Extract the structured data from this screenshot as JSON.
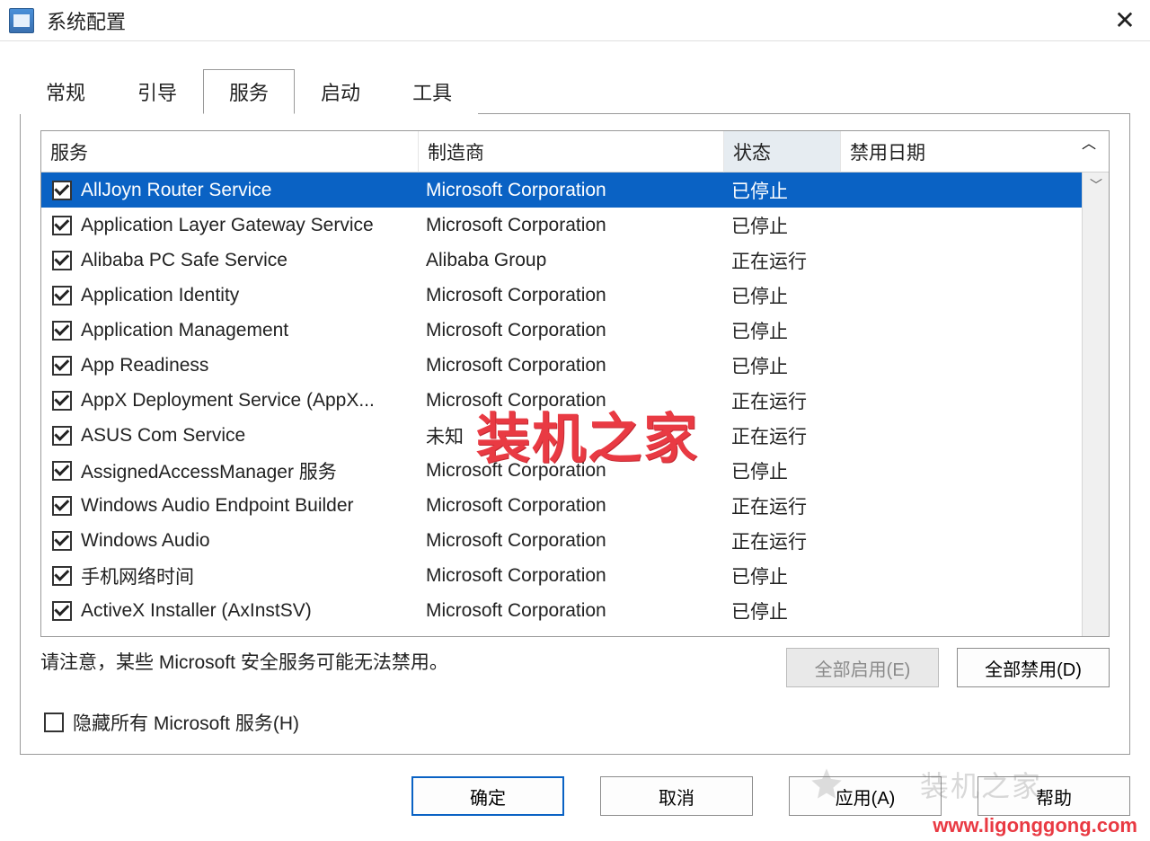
{
  "title": "系统配置",
  "tabs": [
    "常规",
    "引导",
    "服务",
    "启动",
    "工具"
  ],
  "activeTab": 2,
  "columns": {
    "service": "服务",
    "manufacturer": "制造商",
    "status": "状态",
    "disableDate": "禁用日期"
  },
  "sortedColumnIndex": 2,
  "rows": [
    {
      "checked": true,
      "service": "AllJoyn Router Service",
      "mfr": "Microsoft Corporation",
      "status": "已停止",
      "selected": true
    },
    {
      "checked": true,
      "service": "Application Layer Gateway Service",
      "mfr": "Microsoft Corporation",
      "status": "已停止"
    },
    {
      "checked": true,
      "service": "Alibaba PC Safe Service",
      "mfr": "Alibaba Group",
      "status": "正在运行"
    },
    {
      "checked": true,
      "service": "Application Identity",
      "mfr": "Microsoft Corporation",
      "status": "已停止"
    },
    {
      "checked": true,
      "service": "Application Management",
      "mfr": "Microsoft Corporation",
      "status": "已停止"
    },
    {
      "checked": true,
      "service": "App Readiness",
      "mfr": "Microsoft Corporation",
      "status": "已停止"
    },
    {
      "checked": true,
      "service": "AppX Deployment Service (AppX...",
      "mfr": "Microsoft Corporation",
      "status": "正在运行"
    },
    {
      "checked": true,
      "service": "ASUS Com Service",
      "mfr": "未知",
      "status": "正在运行"
    },
    {
      "checked": true,
      "service": "AssignedAccessManager 服务",
      "mfr": "Microsoft Corporation",
      "status": "已停止"
    },
    {
      "checked": true,
      "service": "Windows Audio Endpoint Builder",
      "mfr": "Microsoft Corporation",
      "status": "正在运行"
    },
    {
      "checked": true,
      "service": "Windows Audio",
      "mfr": "Microsoft Corporation",
      "status": "正在运行"
    },
    {
      "checked": true,
      "service": "手机网络时间",
      "mfr": "Microsoft Corporation",
      "status": "已停止"
    },
    {
      "checked": true,
      "service": "ActiveX Installer (AxInstSV)",
      "mfr": "Microsoft Corporation",
      "status": "已停止"
    }
  ],
  "noteText": "请注意，某些 Microsoft 安全服务可能无法禁用。",
  "buttons": {
    "enableAll": "全部启用(E)",
    "disableAll": "全部禁用(D)",
    "hideMs": "隐藏所有 Microsoft 服务(H)",
    "ok": "确定",
    "cancel": "取消",
    "apply": "应用(A)",
    "help": "帮助"
  },
  "hideMsChecked": false,
  "watermark": {
    "center": "装机之家",
    "faint": "装机之家",
    "url": "www.ligonggong.com"
  }
}
